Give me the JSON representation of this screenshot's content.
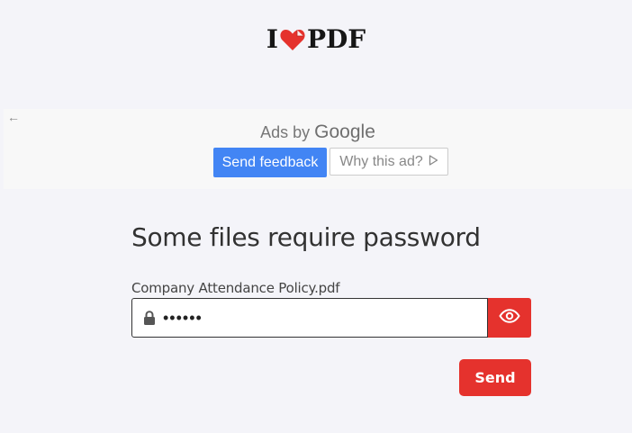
{
  "logo": {
    "prefix": "I",
    "suffix": "PDF",
    "heart_icon": "heart-icon",
    "brand_color": "#e5322d"
  },
  "ad": {
    "back_icon": "arrow-left-icon",
    "ads_by": "Ads by",
    "google": "Google",
    "send_feedback": "Send feedback",
    "why_this_ad": "Why this ad?",
    "why_icon": "play-outline-icon",
    "feedback_color": "#4285f4"
  },
  "form": {
    "title": "Some files require password",
    "file_name": "Company Attendance Policy.pdf",
    "password_value": "••••••",
    "lock_icon": "lock-icon",
    "eye_icon": "eye-icon",
    "send_label": "Send",
    "accent": "#e5322d"
  }
}
